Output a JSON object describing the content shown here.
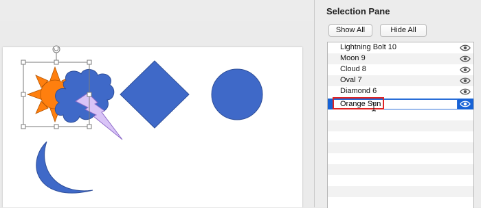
{
  "selection_pane": {
    "title": "Selection Pane",
    "show_all_label": "Show All",
    "hide_all_label": "Hide All",
    "items": [
      {
        "label": "Lightning Bolt 10",
        "visible": true,
        "selected": false
      },
      {
        "label": "Moon 9",
        "visible": true,
        "selected": false
      },
      {
        "label": "Cloud 8",
        "visible": true,
        "selected": false
      },
      {
        "label": "Oval 7",
        "visible": true,
        "selected": false
      },
      {
        "label": "Diamond 6",
        "visible": true,
        "selected": false
      },
      {
        "label": "Orange Sun",
        "visible": true,
        "selected": true,
        "editing": true
      }
    ]
  },
  "slide": {
    "shapes": [
      {
        "name": "Orange Sun",
        "fill": "#ff7f0e",
        "selected": true
      },
      {
        "name": "Cloud 8",
        "fill": "#3f69c8"
      },
      {
        "name": "Lightning Bolt 10",
        "fill": "#d9c4f7"
      },
      {
        "name": "Diamond 6",
        "fill": "#3f69c8"
      },
      {
        "name": "Oval 7",
        "fill": "#3f69c8"
      },
      {
        "name": "Moon 9",
        "fill": "#3f69c8"
      }
    ]
  },
  "colors": {
    "selection_blue": "#1662d6",
    "highlight_red": "#e02424",
    "shape_blue": "#3f69c8",
    "sun_orange": "#ff7f0e"
  }
}
